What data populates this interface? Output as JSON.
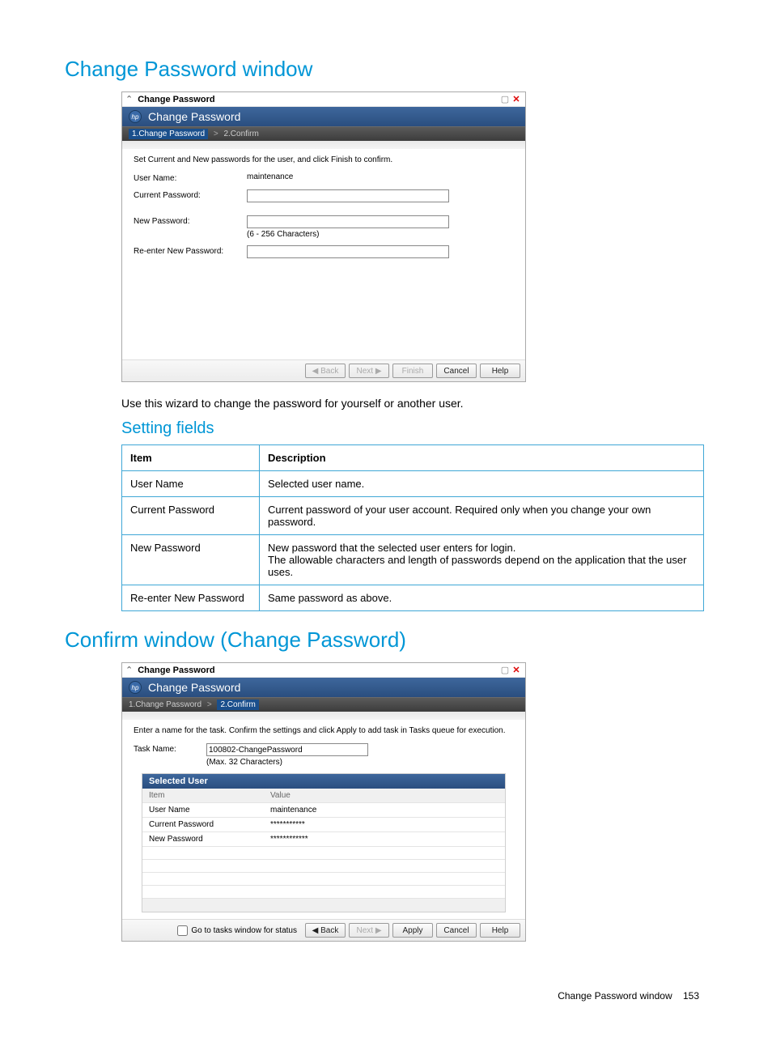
{
  "section1": {
    "title": "Change Password window",
    "intro": "Use this wizard to change the password for yourself or another user.",
    "subsection": "Setting fields"
  },
  "section2": {
    "title": "Confirm window (Change Password)"
  },
  "dialog1": {
    "window_title": "Change Password",
    "header": "Change Password",
    "breadcrumb": {
      "step1": "1.Change Password",
      "sep": ">",
      "step2": "2.Confirm"
    },
    "instruction": "Set Current and New passwords for the user, and click Finish to confirm.",
    "fields": {
      "username_label": "User Name:",
      "username_value": "maintenance",
      "current_label": "Current Password:",
      "new_label": "New Password:",
      "new_hint": "(6 - 256 Characters)",
      "reenter_label": "Re-enter New Password:"
    },
    "buttons": {
      "back": "◀ Back",
      "next": "Next ▶",
      "finish": "Finish",
      "cancel": "Cancel",
      "help": "Help"
    }
  },
  "dialog2": {
    "window_title": "Change Password",
    "header": "Change Password",
    "breadcrumb": {
      "step1": "1.Change Password",
      "sep": ">",
      "step2": "2.Confirm"
    },
    "instruction": "Enter a name for the task. Confirm the settings and click Apply to add task in Tasks queue for execution.",
    "taskname_label": "Task Name:",
    "taskname_value": "100802-ChangePassword",
    "taskname_hint": "(Max. 32 Characters)",
    "selected_user_header": "Selected User",
    "table": {
      "h_item": "Item",
      "h_value": "Value",
      "rows": [
        {
          "item": "User Name",
          "value": "maintenance"
        },
        {
          "item": "Current Password",
          "value": "***********"
        },
        {
          "item": "New Password",
          "value": "************"
        }
      ]
    },
    "check_label": "Go to tasks window for status",
    "buttons": {
      "back": "◀ Back",
      "next": "Next ▶",
      "apply": "Apply",
      "cancel": "Cancel",
      "help": "Help"
    }
  },
  "desc_table": {
    "h_item": "Item",
    "h_desc": "Description",
    "rows": [
      {
        "item": "User Name",
        "desc": "Selected user name."
      },
      {
        "item": "Current Password",
        "desc": "Current password of your user account. Required only when you change your own password."
      },
      {
        "item": "New Password",
        "desc": "New password that the selected user enters for login.\nThe allowable characters and length of passwords depend on the application that the user uses."
      },
      {
        "item": "Re-enter New Password",
        "desc": "Same password as above."
      }
    ]
  },
  "footer": {
    "text": "Change Password window",
    "page": "153"
  }
}
